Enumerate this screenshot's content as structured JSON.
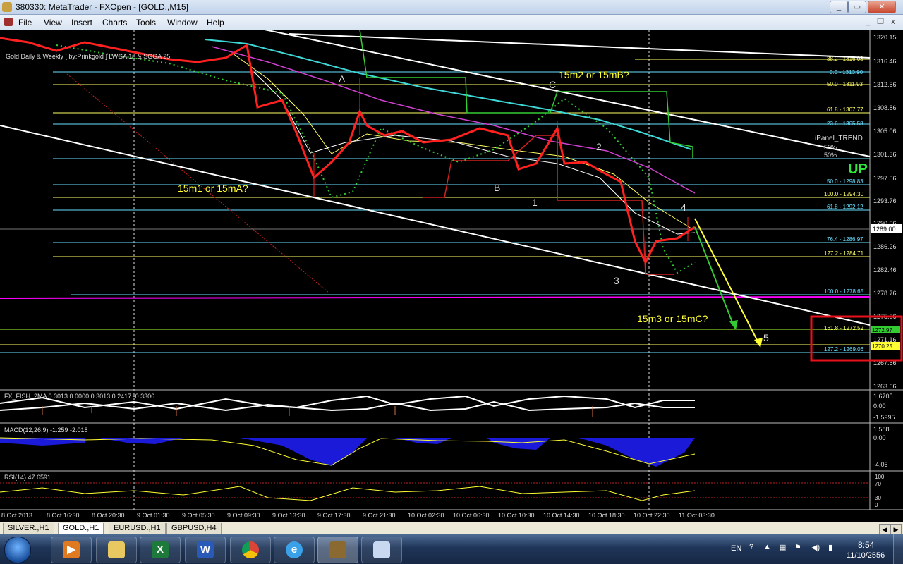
{
  "window": {
    "title": "380330: MetaTrader - FXOpen - [GOLD,,M15]",
    "min_label": "_",
    "max_label": "▭",
    "close_label": "✕"
  },
  "menu": [
    "File",
    "View",
    "Insert",
    "Charts",
    "Tools",
    "Window",
    "Help"
  ],
  "mdi": {
    "min": "_",
    "restore": "❐",
    "close": "x"
  },
  "chart": {
    "indicator_label": "Gold Daily & Weekly [ by:Prinkgold ] LWGA 10 & SGGA 25",
    "current_price": "1289.00",
    "price_axis": [
      "1320.15",
      "1316.46",
      "1312.56",
      "1308.86",
      "1305.06",
      "1301.36",
      "1297.56",
      "1293.76",
      "1290.06",
      "1286.26",
      "1282.46",
      "1278.76",
      "1275.06",
      "1271.16",
      "1267.56",
      "1263.66"
    ],
    "fib_levels": [
      {
        "label": "38.2 - 1316.08",
        "color": "#ffff66"
      },
      {
        "label": "0.0 - 1313.90",
        "color": "#66e0ff"
      },
      {
        "label": "50.0 - 1311.93",
        "color": "#ffff66"
      },
      {
        "label": "61.8 - 1307.77",
        "color": "#ffff66"
      },
      {
        "label": "23.6 - 1305.58",
        "color": "#66e0ff"
      },
      {
        "label": "50.0 - 1298.83",
        "color": "#66e0ff"
      },
      {
        "label": "100.0 - 1294.30",
        "color": "#ffff66"
      },
      {
        "label": "61.8 - 1292.12",
        "color": "#66e0ff"
      },
      {
        "label": "76.4 - 1286.97",
        "color": "#66e0ff"
      },
      {
        "label": "127.2 - 1284.71",
        "color": "#ffff66"
      },
      {
        "label": "100.0 - 1278.65",
        "color": "#66e0ff"
      },
      {
        "label": "161.8 - 1272.52",
        "color": "#ffff66"
      },
      {
        "label": "127.2 - 1269.06",
        "color": "#66e0ff"
      }
    ],
    "target_prices": [
      "1272.97",
      "1270.25"
    ],
    "trend_panel": {
      "title": "iPanel_TREND",
      "p1": "50%",
      "p2": "50%",
      "signal": "UP"
    },
    "annotations": {
      "a": "A",
      "b": "B",
      "c": "C",
      "w1": "1",
      "w2": "2",
      "w3": "3",
      "w4": "4",
      "w5": "5",
      "m1": "15m1 or 15mA?",
      "m2": "15m2 or 15mB?",
      "m3": "15m3 or 15mC?"
    },
    "fish_label": "FX_FISH_2MA 0.3013 0.0000 0.3013 0.2417 -0.3306",
    "fish_axis": [
      "1.6705",
      "0.00",
      "-1.5995"
    ],
    "macd_label": "MACD(12,26,9) -1.259 -2.018",
    "macd_axis": [
      "1.588",
      "0.00",
      "-4.05"
    ],
    "rsi_label": "RSI(14) 47.6591",
    "rsi_axis": [
      "100",
      "70",
      "30",
      "0"
    ],
    "time_axis": [
      "8 Oct 2013",
      "8 Oct 16:30",
      "8 Oct 20:30",
      "9 Oct 01:30",
      "9 Oct 05:30",
      "9 Oct 09:30",
      "9 Oct 13:30",
      "9 Oct 17:30",
      "9 Oct 21:30",
      "10 Oct 02:30",
      "10 Oct 06:30",
      "10 Oct 10:30",
      "10 Oct 14:30",
      "10 Oct 18:30",
      "10 Oct 22:30",
      "11 Oct 03:30"
    ]
  },
  "tabs": [
    "SILVER.,H1",
    "GOLD.,H1",
    "EURUSD.,H1",
    "GBPUSD,H4"
  ],
  "taskbar": {
    "lang": "EN",
    "time": "8:54",
    "date": "11/10/2556"
  },
  "colors": {
    "up_candle": "#ff2020",
    "fib_yellow": "#ffff66",
    "fib_cyan": "#66e0ff",
    "magenta_line": "#ff00ff",
    "green_line": "#adff2f",
    "target_box": "#e8101a"
  }
}
